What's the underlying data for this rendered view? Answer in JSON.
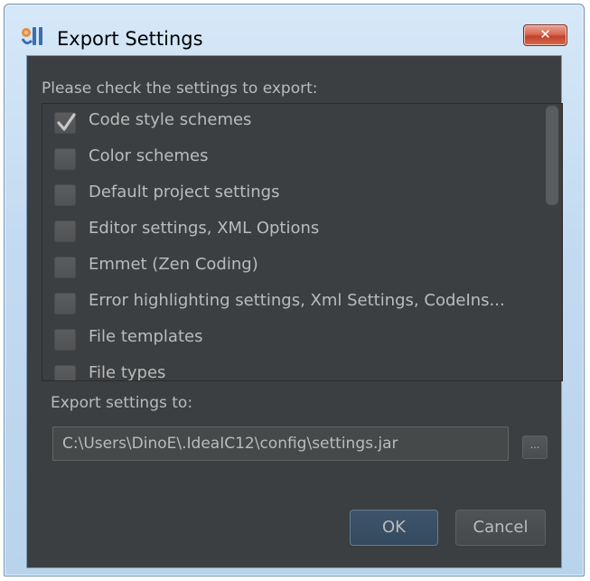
{
  "window": {
    "title": "Export Settings",
    "close_label": "✕"
  },
  "dialog": {
    "prompt": "Please check the settings to export:",
    "items": [
      {
        "label": "Code style schemes",
        "checked": true
      },
      {
        "label": "Color schemes",
        "checked": false
      },
      {
        "label": "Default project settings",
        "checked": false
      },
      {
        "label": "Editor settings, XML Options",
        "checked": false
      },
      {
        "label": "Emmet (Zen Coding)",
        "checked": false
      },
      {
        "label": "Error highlighting settings, Xml Settings, CodeIns...",
        "checked": false
      },
      {
        "label": "File templates",
        "checked": false
      },
      {
        "label": "File types",
        "checked": false
      }
    ],
    "export_label": "Export settings to:",
    "export_path": "C:\\Users\\DinoE\\.IdeaIC12\\config\\settings.jar",
    "browse_label": "...",
    "ok_label": "OK",
    "cancel_label": "Cancel"
  },
  "colors": {
    "panel_bg": "#3c3f41",
    "text": "#bbbbbb",
    "ok_bg": "#3e546a",
    "close_red": "#c1432a"
  }
}
